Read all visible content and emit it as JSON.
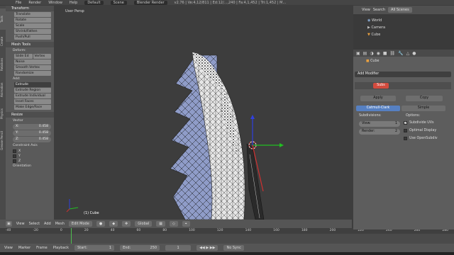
{
  "topbar": {
    "menus": [
      "File",
      "Render",
      "Window",
      "Help"
    ],
    "layout": "Default",
    "scene": "Scene",
    "engine": "Blender Render",
    "stats": "v2.76 | Ve:4,12/811 | Ed:12/...,240 | Fa:4,1,452 | Tri:1,452 | M..."
  },
  "tool_tabs": [
    "Tools",
    "Create",
    "Relations",
    "Animation",
    "Physics",
    "Grease Pencil"
  ],
  "tools": {
    "transform_header": "Transform",
    "transform_buttons": [
      "Translate",
      "Rotate",
      "Scale",
      "Shrink/Fatten",
      "Push/Pull"
    ],
    "mesh_tools_header": "Mesh Tools",
    "deform_label": "Deform:",
    "slide_buttons": [
      "Slide Ed",
      "Vertex"
    ],
    "deform_buttons": [
      "Noise",
      "Smooth Vertex",
      "Randomize"
    ],
    "add_label": "Add:",
    "extrude_select": "Extrude",
    "add_buttons": [
      "Extrude Region",
      "Extrude Individual",
      "Inset Faces",
      "Make Edge/Face"
    ],
    "resize_header": "Resize",
    "vector_label": "Vector",
    "vector": [
      {
        "axis": "X:",
        "value": "0.458"
      },
      {
        "axis": "Y:",
        "value": "0.458"
      },
      {
        "axis": "Z:",
        "value": "0.458"
      }
    ],
    "constraint_label": "Constraint Axis",
    "constraint_axes": [
      "X",
      "Y",
      "Z"
    ],
    "orientation_label": "Orientation"
  },
  "viewport": {
    "title": "User Persp",
    "object_label": "(1) Cube"
  },
  "viewport_header": {
    "menus": [
      "View",
      "Select",
      "Add",
      "Mesh"
    ],
    "mode": "Edit Mode",
    "orientation": "Global"
  },
  "timeline": {
    "ticks": [
      "-40",
      "-20",
      "0",
      "20",
      "40",
      "60",
      "80",
      "100",
      "120",
      "140",
      "160",
      "180",
      "200",
      "220",
      "240",
      "260",
      "280"
    ],
    "menus": [
      "View",
      "Marker",
      "Frame",
      "Playback"
    ],
    "start_label": "Start:",
    "start_value": "1",
    "end_label": "End:",
    "end_value": "250",
    "current_frame": "1",
    "sync": "No Sync"
  },
  "outliner": {
    "tabs": [
      "View",
      "Search"
    ],
    "scope": "All Scenes",
    "items": [
      "World",
      "Camera",
      "Cube"
    ]
  },
  "properties": {
    "object_name": "Cube",
    "add_modifier": "Add Modifier",
    "modifier_name": "Subs",
    "apply": "Apply",
    "copy": "Copy",
    "catmull": "Catmull-Clark",
    "simple": "Simple",
    "subdivisions_label": "Subdivisions:",
    "options_label": "Options:",
    "view_label": "View:",
    "view_value": "1",
    "render_label": "Render:",
    "render_value": "2",
    "subdivide_uvs": "Subdivide UVs",
    "optimal_display": "Optimal Display",
    "use_opensubdiv": "Use OpenSubdiv"
  },
  "colors": {
    "accent": "#5680c2",
    "modifier_red": "#d24b3e",
    "mesh_blue": "#8f9cc8"
  }
}
